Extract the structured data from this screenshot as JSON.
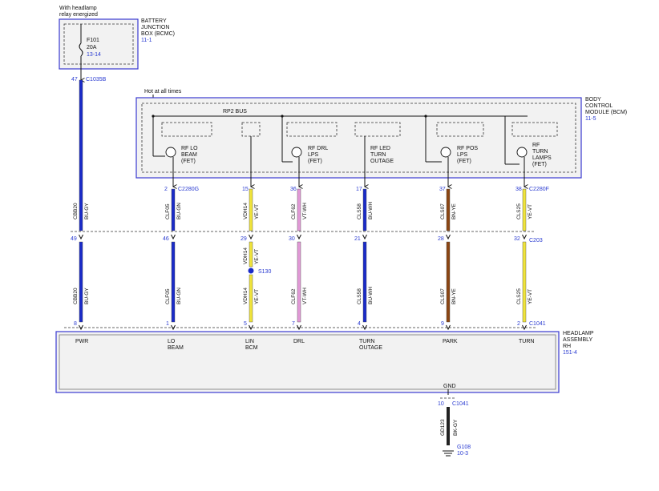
{
  "top_note": [
    "With headlamp",
    "relay energized"
  ],
  "bjb": {
    "title": [
      "BATTERY",
      "JUNCTION",
      "BOX (BCMC)"
    ],
    "ref": "11-1",
    "fuse_id": "F101",
    "fuse_rating": "20A",
    "fuse_ref": "13-14",
    "pin": "47",
    "connector": "C1035B"
  },
  "bcm": {
    "title": [
      "BODY",
      "CONTROL",
      "MODULE (BCM)"
    ],
    "ref": "11-5",
    "hot_note": "Hot at all times",
    "bus_label": "RP2 BUS",
    "drivers": [
      {
        "id": "lo",
        "label": [
          "RF LO",
          "BEAM",
          "(FET)"
        ]
      },
      {
        "id": "drl",
        "label": [
          "RF DRL",
          "LPS",
          "(FET)"
        ]
      },
      {
        "id": "led",
        "label": [
          "RF LED",
          "TURN",
          "OUTAGE"
        ]
      },
      {
        "id": "pos",
        "label": [
          "RF POS",
          "LPS",
          "(FET)"
        ]
      },
      {
        "id": "turn",
        "label": [
          "RF",
          "TURN",
          "LAMPS",
          "(FET)"
        ]
      }
    ]
  },
  "wires": [
    {
      "id": "pwr",
      "upper": {
        "circuit": "CBB20",
        "color_code": "BU-GY"
      },
      "lower": {
        "circuit": "CBB20",
        "color_code": "BU-GY"
      },
      "pin_c203": "49",
      "pin_c1041": "8",
      "function": [
        "PWR"
      ],
      "color": "#1a2bc8"
    },
    {
      "id": "lo",
      "upper": {
        "circuit": "CLF05",
        "color_code": "BU-GN"
      },
      "lower": {
        "circuit": "CLF05",
        "color_code": "BU-GN"
      },
      "pin_bcm": "2",
      "bcm_connector": "C2280G",
      "pin_c203": "46",
      "pin_c1041": "1",
      "function": [
        "LO",
        "BEAM"
      ],
      "color": "#1a2bc8"
    },
    {
      "id": "lin",
      "upper": {
        "circuit": "VDH14",
        "color_code": "YE-VT"
      },
      "mid": {
        "circuit": "VDH14",
        "color_code": "YE-VT"
      },
      "lower": {
        "circuit": "VDH14",
        "color_code": "YE-VT"
      },
      "pin_bcm": "15",
      "pin_c203": "29",
      "pin_c1041": "5",
      "splice": "S130",
      "function": [
        "LIN",
        "BCM"
      ],
      "color": "#f0e43c"
    },
    {
      "id": "drl",
      "upper": {
        "circuit": "CLF62",
        "color_code": "VT-WH"
      },
      "lower": {
        "circuit": "CLF62",
        "color_code": "VT-WH"
      },
      "pin_bcm": "36",
      "pin_c203": "30",
      "pin_c1041": "7",
      "function": [
        "DRL"
      ],
      "color": "#e39ad8"
    },
    {
      "id": "outage",
      "upper": {
        "circuit": "CLS58",
        "color_code": "BU-WH"
      },
      "lower": {
        "circuit": "CLS58",
        "color_code": "BU-WH"
      },
      "pin_bcm": "17",
      "pin_c203": "21",
      "pin_c1041": "4",
      "function": [
        "TURN",
        "OUTAGE"
      ],
      "color": "#1a2bc8"
    },
    {
      "id": "park",
      "upper": {
        "circuit": "CLS07",
        "color_code": "BN-YE"
      },
      "lower": {
        "circuit": "CLS07",
        "color_code": "BN-YE"
      },
      "pin_bcm": "37",
      "pin_c203": "28",
      "pin_c1041": "9",
      "function": [
        "PARK"
      ],
      "color": "#8b4513"
    },
    {
      "id": "turn",
      "upper": {
        "circuit": "CLS25",
        "color_code": "YE-VT"
      },
      "lower": {
        "circuit": "CLS25",
        "color_code": "YE-VT"
      },
      "pin_bcm": "38",
      "bcm_connector": "C2280F",
      "pin_c203": "32",
      "c203": "C203",
      "pin_c1041": "2",
      "c1041": "C1041",
      "function": [
        "TURN"
      ],
      "color": "#f0e43c"
    }
  ],
  "headlamp": {
    "title": [
      "HEADLAMP",
      "ASSEMBLY",
      "RH"
    ],
    "ref": "151-4",
    "gnd_label": "GND",
    "gnd_pin": "10",
    "gnd_connector": "C1041",
    "gnd_circuit": "GD123",
    "gnd_color_code": "BK-GY",
    "ground_id": "G108",
    "ground_ref": "10-3"
  }
}
